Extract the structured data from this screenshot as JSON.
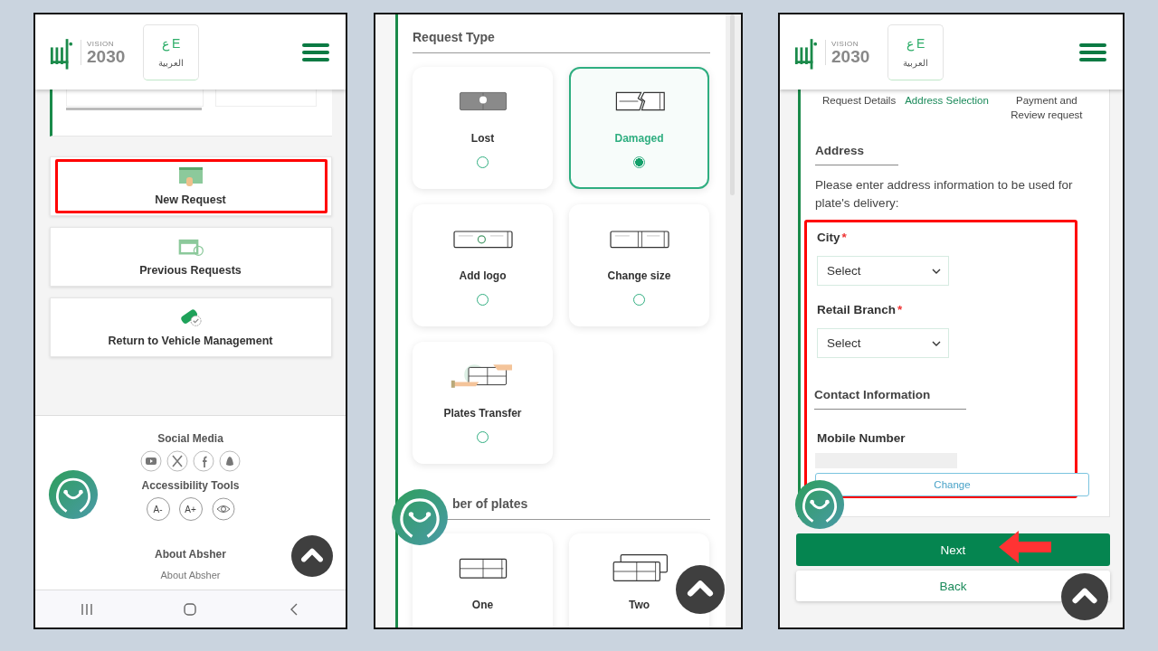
{
  "screen_1": {
    "header": {
      "vision_logo": {
        "label": "VISION",
        "year": "2030"
      },
      "language_button": {
        "letters": [
          "ع",
          "E"
        ],
        "label": "العربية"
      }
    },
    "menu_cards": [
      {
        "kind": "new",
        "label": "New Request",
        "highlighted": true
      },
      {
        "kind": "previous",
        "label": "Previous Requests",
        "highlighted": false
      },
      {
        "kind": "return",
        "label": "Return to Vehicle Management",
        "highlighted": false
      }
    ],
    "footer": {
      "social_title": "Social Media",
      "social_links": [
        {
          "kind": "youtube"
        },
        {
          "kind": "x"
        },
        {
          "kind": "facebook"
        },
        {
          "kind": "snapchat"
        }
      ],
      "accessibility_title": "Accessibility Tools",
      "accessibility_buttons": [
        {
          "kind": "text",
          "label": "A-"
        },
        {
          "kind": "text",
          "label": "A+"
        },
        {
          "kind": "eye"
        }
      ],
      "about_title": "About Absher",
      "about_link": "About Absher"
    }
  },
  "screen_2": {
    "request_type_title": "Request Type",
    "request_types": [
      {
        "kind": "lost",
        "label": "Lost",
        "selected": false
      },
      {
        "kind": "damaged",
        "label": "Damaged",
        "selected": true
      },
      {
        "kind": "logo",
        "label": "Add logo",
        "selected": false
      },
      {
        "kind": "size",
        "label": "Change size",
        "selected": false
      },
      {
        "kind": "transfer",
        "label": "Plates Transfer",
        "selected": false
      }
    ],
    "plates_title": "ber of plates",
    "plate_counts": [
      {
        "kind": "one",
        "label": "One"
      },
      {
        "kind": "two",
        "label": "Two"
      }
    ]
  },
  "screen_3": {
    "header": {
      "vision_logo": {
        "label": "VISION",
        "year": "2030"
      },
      "language_button": {
        "letters": [
          "ع",
          "E"
        ],
        "label": "العربية"
      }
    },
    "steps": [
      {
        "label": "Request Details",
        "selected": false
      },
      {
        "label": "Address Selection",
        "selected": true
      },
      {
        "label": "Payment and Review request",
        "selected": false
      }
    ],
    "address_title": "Address",
    "address_note": "Please enter address information to be used for plate's delivery:",
    "fields": [
      {
        "label": "City",
        "marker": "*",
        "value": "Select"
      },
      {
        "label": "Retail Branch",
        "marker": "*",
        "value": "Select"
      }
    ],
    "contact_title": "Contact Information",
    "mobile_label": "Mobile Number",
    "change_button": "Change",
    "next_button": "Next",
    "back_button": "Back"
  }
}
